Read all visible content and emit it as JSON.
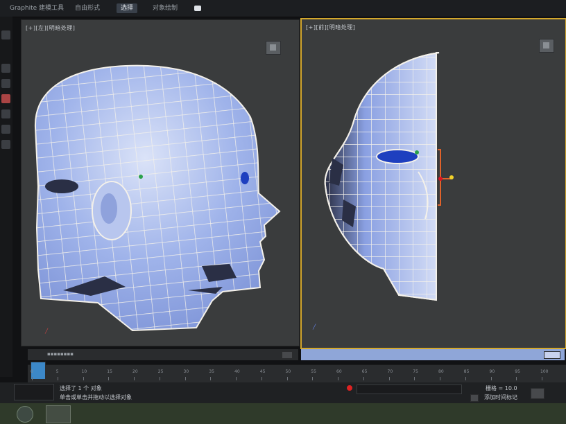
{
  "app": {
    "menu": [
      {
        "label": "Graphite 建模工具"
      },
      {
        "label": "自由形式"
      },
      {
        "label": "选择"
      },
      {
        "label": "对象绘制"
      }
    ],
    "active_menu": 2
  },
  "viewports": {
    "left": {
      "label": "[+][左][明暗处理]"
    },
    "right": {
      "label": "[+][前][明暗处理]"
    }
  },
  "timeline": {
    "ticks": [
      "0",
      "5",
      "10",
      "15",
      "20",
      "25",
      "30",
      "35",
      "40",
      "45",
      "50",
      "55",
      "60",
      "65",
      "70",
      "75",
      "80",
      "85",
      "90",
      "95",
      "100"
    ]
  },
  "status": {
    "selection": "选择了 1 个 对象",
    "hint": "单击或单击并拖动以选择对象",
    "add_tag": "添加时间标记",
    "grid_label": "栅格 = 10.0"
  },
  "colors": {
    "viewport_bg": "#3a3c3d",
    "mesh_fill": "#8fa6e6",
    "mesh_light": "#c6d2f4",
    "mesh_dark": "#2a2f45",
    "wire": "#f4f1ea",
    "gizmo": "#e0622a",
    "active_frame": "#d4a82c"
  },
  "icons": {
    "start": "windows-start-icon",
    "viewcube": "viewcube-icon"
  }
}
